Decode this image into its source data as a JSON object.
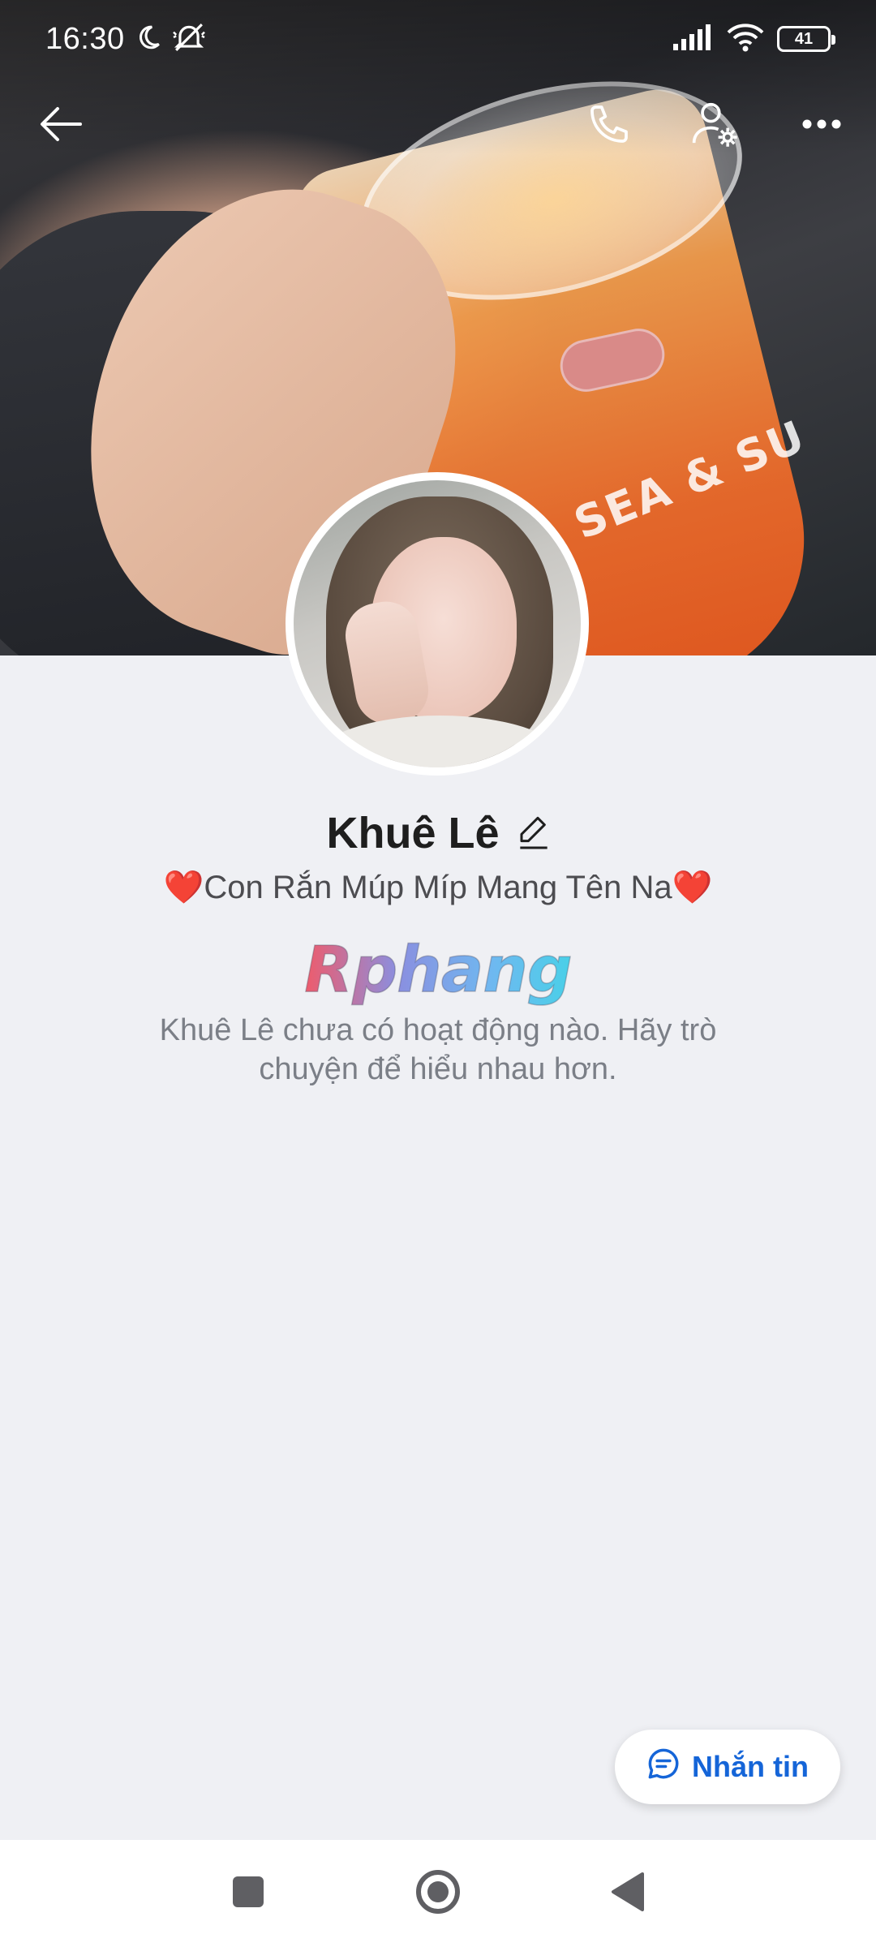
{
  "status_bar": {
    "time": "16:30",
    "battery": "41"
  },
  "toolbar": {
    "back_icon": "arrow-left-icon",
    "call_icon": "phone-icon",
    "settings_icon": "user-settings-icon",
    "more_icon": "more-horizontal-icon"
  },
  "profile": {
    "name": "Khuê Lê",
    "bio_heart_left": "❤️",
    "bio_text": "Con Rắn Múp Míp Mang Tên Na",
    "bio_heart_right": "❤️",
    "watermark": "Rphang",
    "empty_state": "Khuê Lê chưa có hoạt động nào. Hãy trò chuyện để hiểu nhau hơn."
  },
  "message_button": {
    "label": "Nhắn tin",
    "icon": "chat-bubble-icon",
    "color": "#1565d8"
  },
  "cover": {
    "cup_text": "SEA & SU"
  },
  "nav_bar": {
    "recents_icon": "square-icon",
    "home_icon": "circle-icon",
    "back_icon": "triangle-back-icon"
  }
}
